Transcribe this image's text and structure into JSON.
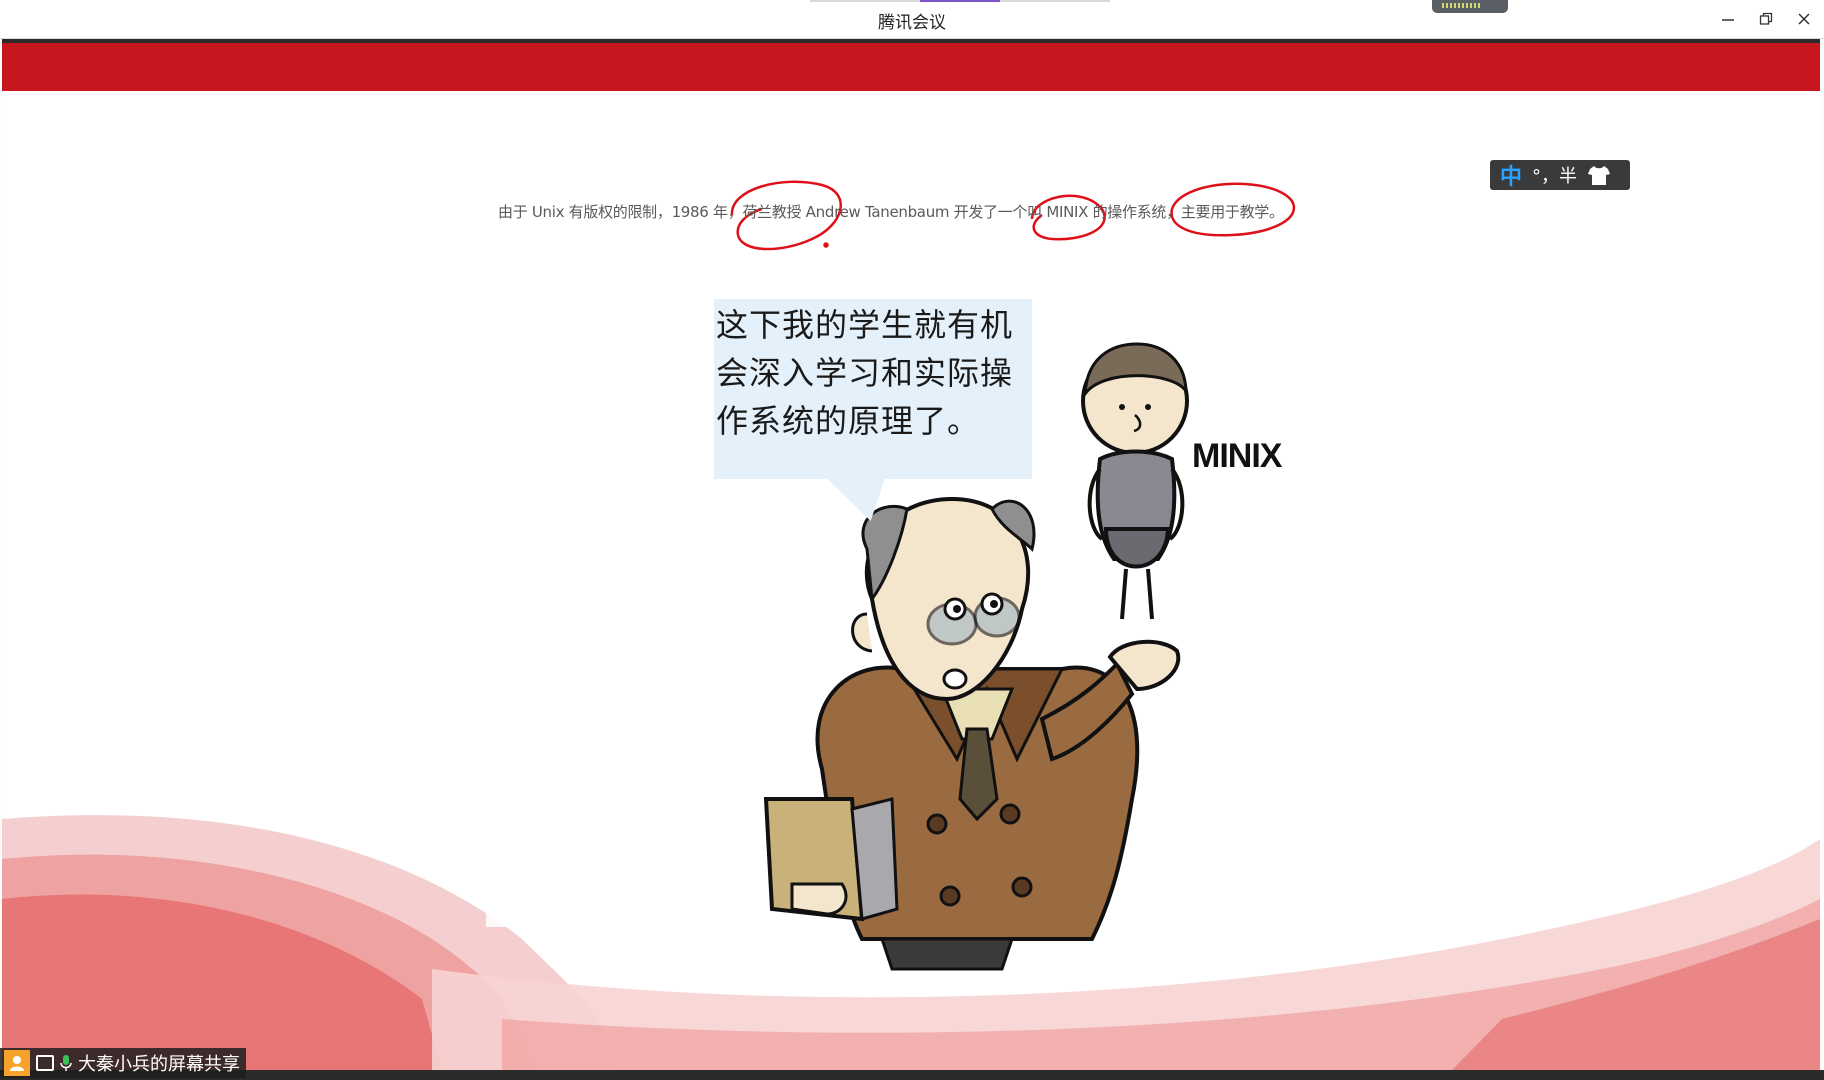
{
  "window": {
    "title": "腾讯会议"
  },
  "slide": {
    "caption": "由于 Unix 有版权的限制，1986 年，荷兰教授 Andrew Tanenbaum 开发了一个叫 MINIX 的操作系统，主要用于教学。",
    "speech_bubble": {
      "line1": "这下我的学生就有机",
      "line2": "会深入学习和实际操",
      "line3": "作系统的原理了。"
    },
    "doll_label": "MINIX"
  },
  "ime": {
    "mode": "中",
    "symbols": "°，半",
    "skin_icon": "shirt-icon"
  },
  "status_bar": {
    "share_label": "大秦小兵的屏幕共享"
  },
  "colors": {
    "brand_red": "#c8161f",
    "annotation_red": "#e0101a",
    "ime_blue": "#2aa2ff"
  }
}
